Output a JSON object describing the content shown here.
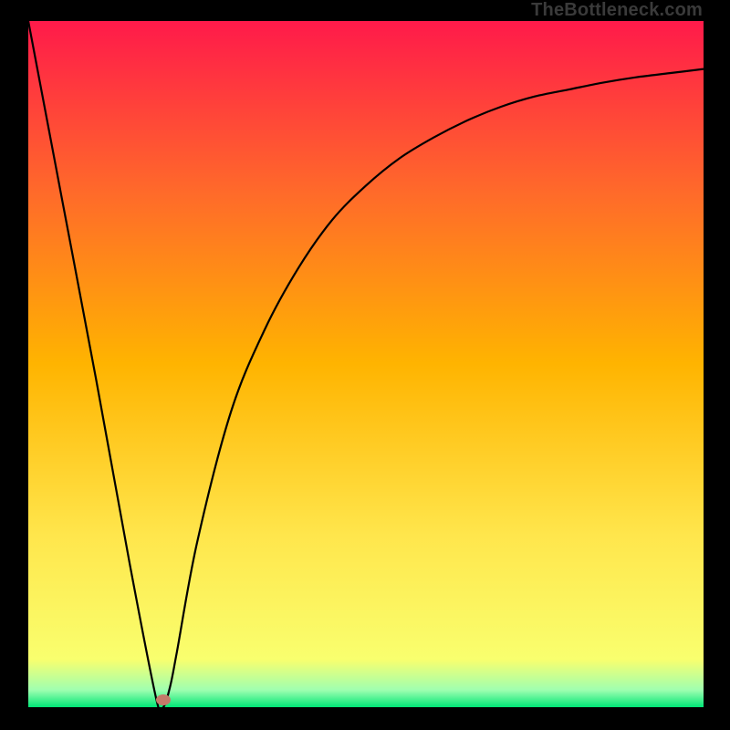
{
  "watermark": "TheBottleneck.com",
  "chart_data": {
    "type": "line",
    "title": "",
    "xlabel": "",
    "ylabel": "",
    "xlim": [
      0,
      100
    ],
    "ylim": [
      0,
      100
    ],
    "gradient_stops": [
      {
        "offset": 0.0,
        "color": "#ff1a4a"
      },
      {
        "offset": 0.25,
        "color": "#ff6a2a"
      },
      {
        "offset": 0.5,
        "color": "#ffb400"
      },
      {
        "offset": 0.75,
        "color": "#ffe64c"
      },
      {
        "offset": 0.93,
        "color": "#f9ff6e"
      },
      {
        "offset": 0.975,
        "color": "#9fffb0"
      },
      {
        "offset": 1.0,
        "color": "#00e676"
      }
    ],
    "series": [
      {
        "name": "bottleneck-curve",
        "x": [
          0,
          5,
          10,
          15,
          19,
          20,
          21,
          22,
          25,
          30,
          35,
          40,
          45,
          50,
          55,
          60,
          65,
          70,
          75,
          80,
          85,
          90,
          95,
          100
        ],
        "y": [
          100,
          74,
          48,
          21,
          1,
          0,
          3,
          8,
          24,
          43,
          55,
          64,
          71,
          76,
          80,
          83,
          85.5,
          87.5,
          89,
          90,
          91,
          91.8,
          92.4,
          93
        ]
      }
    ],
    "marker": {
      "x": 20,
      "y": 1,
      "color": "#c47a6a"
    }
  }
}
